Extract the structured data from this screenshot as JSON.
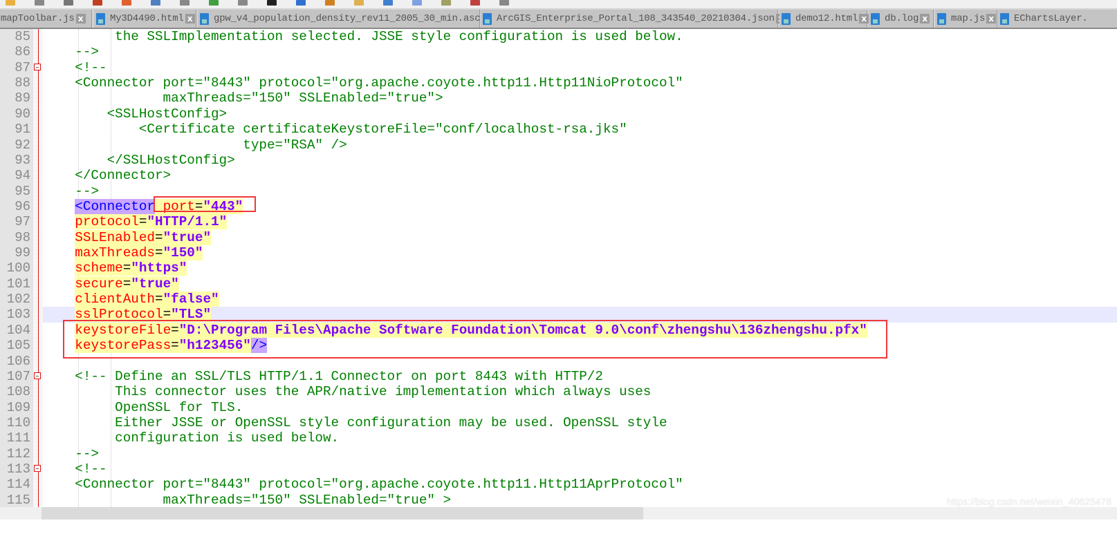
{
  "tabs": [
    {
      "label": "mapToolbar.js"
    },
    {
      "label": "My3D4490.html"
    },
    {
      "label": "gpw_v4_population_density_rev11_2005_30_min.asc"
    },
    {
      "label": "ArcGIS_Enterprise_Portal_108_343540_20210304.json"
    },
    {
      "label": "demo12.html"
    },
    {
      "label": "db.log"
    },
    {
      "label": "map.js"
    },
    {
      "label": "EChartsLayer."
    }
  ],
  "tab_close_glyph": "x",
  "colors": {
    "comment": "#008000",
    "tag": "#0000ff",
    "attribute": "#ff0000",
    "value": "#8000ff",
    "highlight": "#fdfda8",
    "current_line": "#e8e8ff",
    "annotation_box": "#f03838"
  },
  "editor": {
    "current_line": 103,
    "lines": [
      {
        "n": "85",
        "tokens": [
          [
            "c",
            "         the SSLImplementation selected. JSSE style configuration is used below."
          ]
        ]
      },
      {
        "n": "86",
        "tokens": [
          [
            "c",
            "    -->"
          ]
        ]
      },
      {
        "n": "87",
        "fold": true,
        "tokens": [
          [
            "c",
            "    <!--"
          ]
        ]
      },
      {
        "n": "88",
        "tokens": [
          [
            "c",
            "    <Connector port=\"8443\" protocol=\"org.apache.coyote.http11.Http11NioProtocol\""
          ]
        ]
      },
      {
        "n": "89",
        "tokens": [
          [
            "c",
            "               maxThreads=\"150\" SSLEnabled=\"true\">"
          ]
        ]
      },
      {
        "n": "90",
        "tokens": [
          [
            "c",
            "        <SSLHostConfig>"
          ]
        ]
      },
      {
        "n": "91",
        "tokens": [
          [
            "c",
            "            <Certificate certificateKeystoreFile=\"conf/localhost-rsa.jks\""
          ]
        ]
      },
      {
        "n": "92",
        "tokens": [
          [
            "c",
            "                         type=\"RSA\" />"
          ]
        ]
      },
      {
        "n": "93",
        "tokens": [
          [
            "c",
            "        </SSLHostConfig>"
          ]
        ]
      },
      {
        "n": "94",
        "tokens": [
          [
            "c",
            "    </Connector>"
          ]
        ]
      },
      {
        "n": "95",
        "tokens": [
          [
            "c",
            "    -->"
          ]
        ]
      },
      {
        "n": "96",
        "tokens": [
          [
            "s",
            "    "
          ],
          [
            "tB",
            "<Connector"
          ],
          [
            "hl",
            " "
          ],
          [
            "aH",
            "port"
          ],
          [
            "pH",
            "="
          ],
          [
            "vH",
            "\"443\""
          ]
        ]
      },
      {
        "n": "97",
        "tokens": [
          [
            "s",
            "    "
          ],
          [
            "aH",
            "protocol"
          ],
          [
            "pH",
            "="
          ],
          [
            "vH",
            "\"HTTP/1.1\""
          ]
        ]
      },
      {
        "n": "98",
        "tokens": [
          [
            "s",
            "    "
          ],
          [
            "aH",
            "SSLEnabled"
          ],
          [
            "pH",
            "="
          ],
          [
            "vH",
            "\"true\""
          ]
        ]
      },
      {
        "n": "99",
        "tokens": [
          [
            "s",
            "    "
          ],
          [
            "aH",
            "maxThreads"
          ],
          [
            "pH",
            "="
          ],
          [
            "vH",
            "\"150\""
          ]
        ]
      },
      {
        "n": "100",
        "tokens": [
          [
            "s",
            "    "
          ],
          [
            "aH",
            "scheme"
          ],
          [
            "pH",
            "="
          ],
          [
            "vH",
            "\"https\""
          ]
        ]
      },
      {
        "n": "101",
        "tokens": [
          [
            "s",
            "    "
          ],
          [
            "aH",
            "secure"
          ],
          [
            "pH",
            "="
          ],
          [
            "vH",
            "\"true\""
          ]
        ]
      },
      {
        "n": "102",
        "tokens": [
          [
            "s",
            "    "
          ],
          [
            "aH",
            "clientAuth"
          ],
          [
            "pH",
            "="
          ],
          [
            "vH",
            "\"false\""
          ]
        ]
      },
      {
        "n": "103",
        "tokens": [
          [
            "s",
            "    "
          ],
          [
            "aH",
            "sslProtocol"
          ],
          [
            "pH",
            "="
          ],
          [
            "vH",
            "\"TLS\""
          ]
        ]
      },
      {
        "n": "104",
        "tokens": [
          [
            "s",
            "    "
          ],
          [
            "aH",
            "keystoreFile"
          ],
          [
            "pH",
            "="
          ],
          [
            "vH",
            "\"D:\\Program Files\\Apache Software Foundation\\Tomcat 9.0\\conf\\zhengshu\\136zhengshu.pfx\""
          ]
        ]
      },
      {
        "n": "105",
        "tokens": [
          [
            "s",
            "    "
          ],
          [
            "aH",
            "keystorePass"
          ],
          [
            "pH",
            "="
          ],
          [
            "vH",
            "\"h123456\""
          ],
          [
            "tB",
            "/>"
          ]
        ]
      },
      {
        "n": "106",
        "tokens": []
      },
      {
        "n": "107",
        "fold": true,
        "tokens": [
          [
            "c",
            "    <!-- Define an SSL/TLS HTTP/1.1 Connector on port 8443 with HTTP/2"
          ]
        ]
      },
      {
        "n": "108",
        "tokens": [
          [
            "c",
            "         This connector uses the APR/native implementation which always uses"
          ]
        ]
      },
      {
        "n": "109",
        "tokens": [
          [
            "c",
            "         OpenSSL for TLS."
          ]
        ]
      },
      {
        "n": "110",
        "tokens": [
          [
            "c",
            "         Either JSSE or OpenSSL style configuration may be used. OpenSSL style"
          ]
        ]
      },
      {
        "n": "111",
        "tokens": [
          [
            "c",
            "         configuration is used below."
          ]
        ]
      },
      {
        "n": "112",
        "tokens": [
          [
            "c",
            "    -->"
          ]
        ]
      },
      {
        "n": "113",
        "fold": true,
        "tokens": [
          [
            "c",
            "    <!--"
          ]
        ]
      },
      {
        "n": "114",
        "tokens": [
          [
            "c",
            "    <Connector port=\"8443\" protocol=\"org.apache.coyote.http11.Http11AprProtocol\""
          ]
        ]
      },
      {
        "n": "115",
        "tokens": [
          [
            "c",
            "               maxThreads=\"150\" SSLEnabled=\"true\" >"
          ]
        ]
      }
    ]
  },
  "watermark": "https://blog.csdn.net/weixin_40625478"
}
